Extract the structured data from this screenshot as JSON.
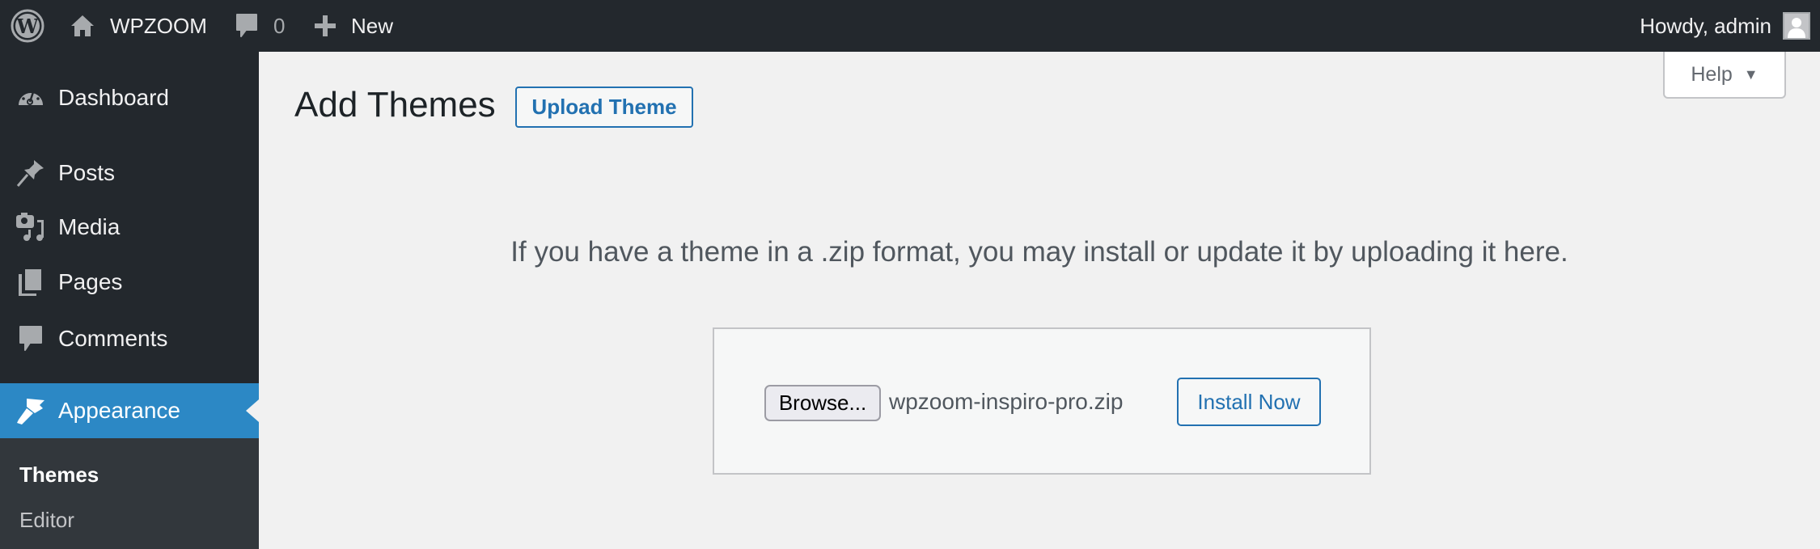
{
  "admin_bar": {
    "site_name": "WPZOOM",
    "comments_count": "0",
    "new_label": "New",
    "greeting": "Howdy, admin",
    "icons": {
      "logo": "wordpress-logo-icon",
      "site": "home-icon",
      "comments": "comment-bubble-icon",
      "new": "plus-icon",
      "avatar": "user-avatar-icon"
    }
  },
  "sidebar": {
    "items": [
      {
        "label": "Dashboard",
        "icon": "dashboard-gauge-icon"
      },
      {
        "label": "Posts",
        "icon": "pushpin-icon"
      },
      {
        "label": "Media",
        "icon": "camera-music-icon"
      },
      {
        "label": "Pages",
        "icon": "pages-icon"
      },
      {
        "label": "Comments",
        "icon": "comment-bubble-icon"
      },
      {
        "label": "Appearance",
        "icon": "paintbrush-icon",
        "active": true
      }
    ],
    "submenu": [
      {
        "label": "Themes",
        "current": true
      },
      {
        "label": "Editor"
      }
    ]
  },
  "help_tab": {
    "label": "Help",
    "caret": "▼"
  },
  "main": {
    "title": "Add Themes",
    "upload_theme_label": "Upload Theme",
    "upload_help": "If you have a theme in a .zip format, you may install or update it by uploading it here.",
    "upload_form": {
      "browse_label": "Browse...",
      "file_name": "wpzoom-inspiro-pro.zip",
      "install_label": "Install Now"
    }
  },
  "colors": {
    "admin_bar_bg": "#23282d",
    "accent": "#2c88c5",
    "link": "#2271b1",
    "page_bg": "#f1f1f1"
  }
}
